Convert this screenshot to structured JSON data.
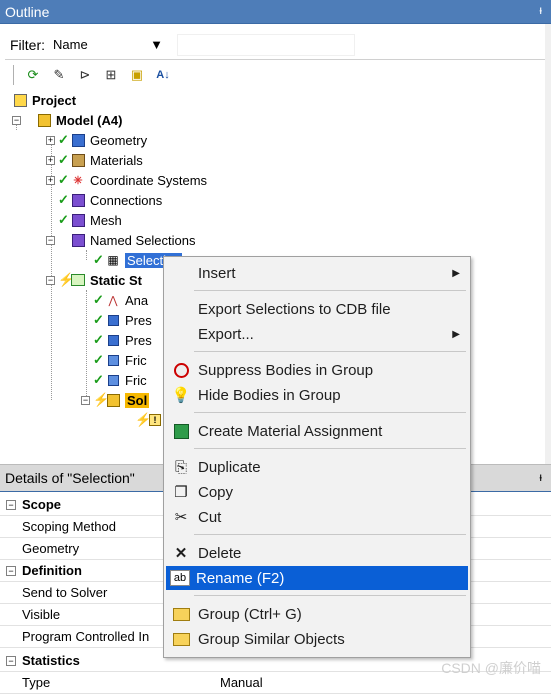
{
  "outline": {
    "title": "Outline",
    "pin_glyph": "ᵻ",
    "filter": {
      "label": "Filter:",
      "value": "Name",
      "input_value": ""
    },
    "toolbar": [
      {
        "name": "refresh-icon",
        "glyph": "⟳"
      },
      {
        "name": "wand-icon",
        "glyph": "✎"
      },
      {
        "name": "tree-icon",
        "glyph": "⊳"
      },
      {
        "name": "expand-icon",
        "glyph": "⊞"
      },
      {
        "name": "folder-icon",
        "glyph": "▣"
      },
      {
        "name": "sort-icon",
        "glyph": "A↓"
      }
    ],
    "tree": {
      "project": "Project",
      "model": "Model (A4)",
      "geometry": "Geometry",
      "materials": "Materials",
      "coordinate_systems": "Coordinate Systems",
      "connections": "Connections",
      "mesh": "Mesh",
      "named_selections": "Named Selections",
      "selection": "Selection",
      "static": "Static St",
      "analysis": "Ana",
      "pres1": "Pres",
      "pres2": "Pres",
      "fric1": "Fric",
      "fric2": "Fric",
      "solution": "Sol"
    }
  },
  "context_menu": {
    "insert": "Insert",
    "export_cdb": "Export Selections to CDB file",
    "export": "Export...",
    "suppress": "Suppress Bodies in Group",
    "hide": "Hide Bodies in Group",
    "create_material": "Create Material Assignment",
    "duplicate": "Duplicate",
    "copy": "Copy",
    "cut": "Cut",
    "delete": "Delete",
    "rename": "Rename (F2)",
    "group": "Group (Ctrl+ G)",
    "group_similar": "Group Similar Objects"
  },
  "details": {
    "title": "Details of \"Selection\"",
    "pin_glyph": "ᵻ",
    "scope": "Scope",
    "scoping_method": "Scoping Method",
    "geometry": "Geometry",
    "definition": "Definition",
    "send_to_solver": "Send to Solver",
    "visible": "Visible",
    "program_controlled": "Program Controlled In",
    "statistics": "Statistics",
    "type": "Type",
    "type_value": "Manual"
  },
  "watermark": "CSDN @廉价喵"
}
